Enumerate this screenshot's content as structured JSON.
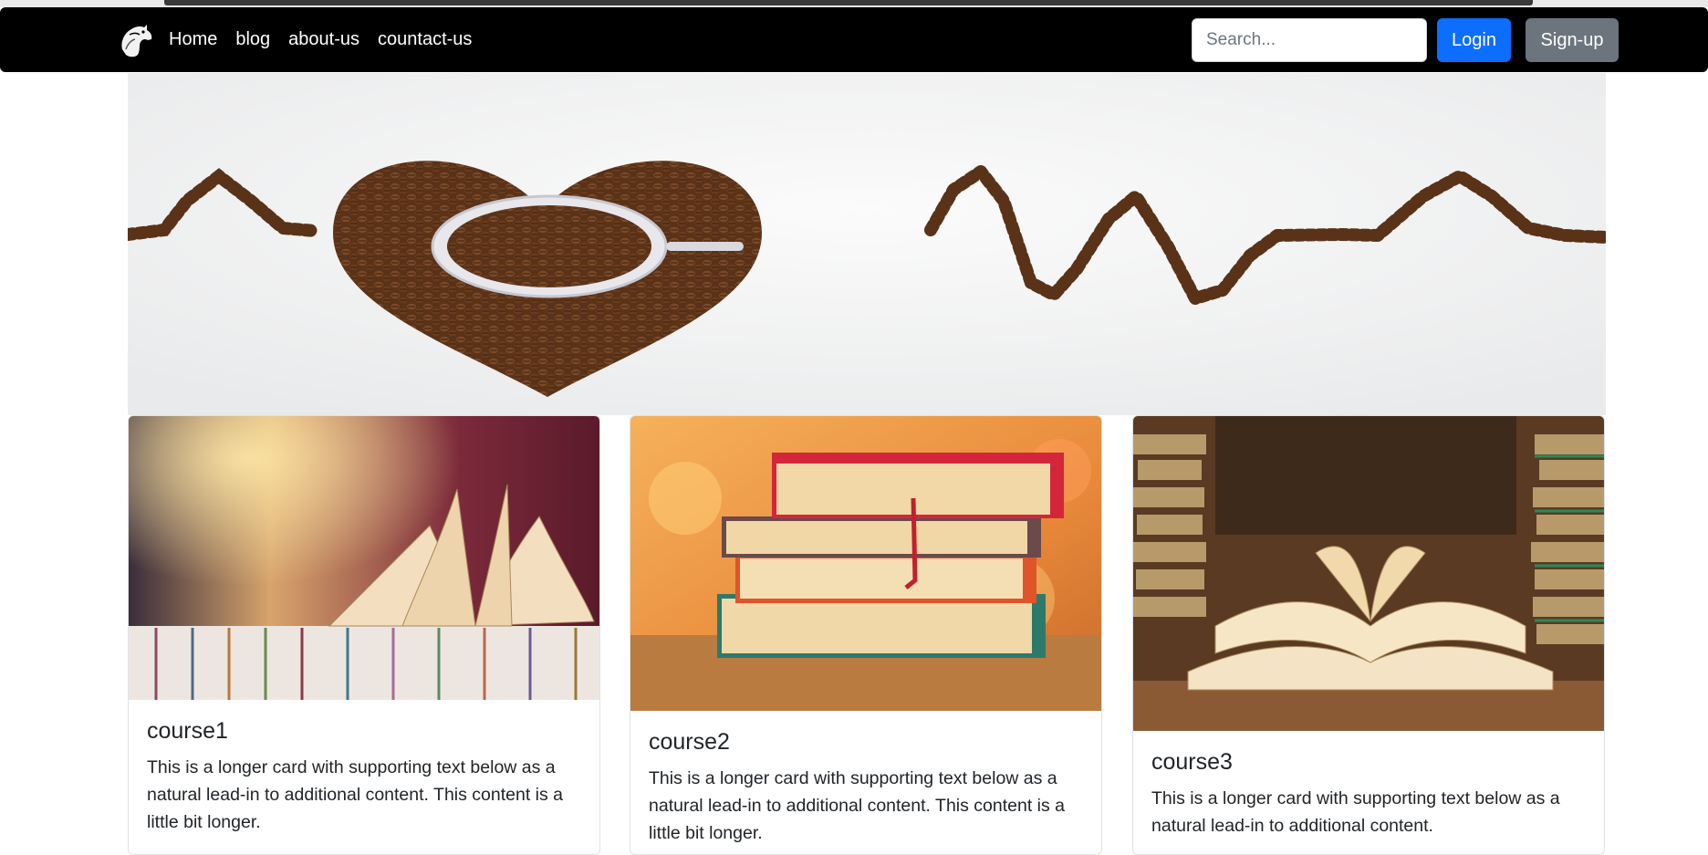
{
  "navbar": {
    "logo_icon": "horse-head-logo-icon",
    "links": [
      "Home",
      "blog",
      "about-us",
      "countact-us"
    ],
    "search": {
      "placeholder": "Search...",
      "value": ""
    },
    "login_label": "Login",
    "signup_label": "Sign-up"
  },
  "hero": {
    "image": "coffee-beans-heartbeat-banner"
  },
  "cards": [
    {
      "image": "open-book-on-stack-photo",
      "title": "course1",
      "text": "This is a longer card with supporting text below as a natural lead-in to additional content. This content is a little bit longer."
    },
    {
      "image": "stacked-books-on-table-photo",
      "title": "course2",
      "text": "This is a longer card with supporting text below as a natural lead-in to additional content. This content is a little bit longer."
    },
    {
      "image": "library-open-books-photo",
      "title": "course3",
      "text": "This is a longer card with supporting text below as a natural lead-in to additional content."
    }
  ],
  "colors": {
    "navbar_bg": "#000000",
    "login_bg": "#0d6efd",
    "signup_bg": "#6c757d"
  }
}
